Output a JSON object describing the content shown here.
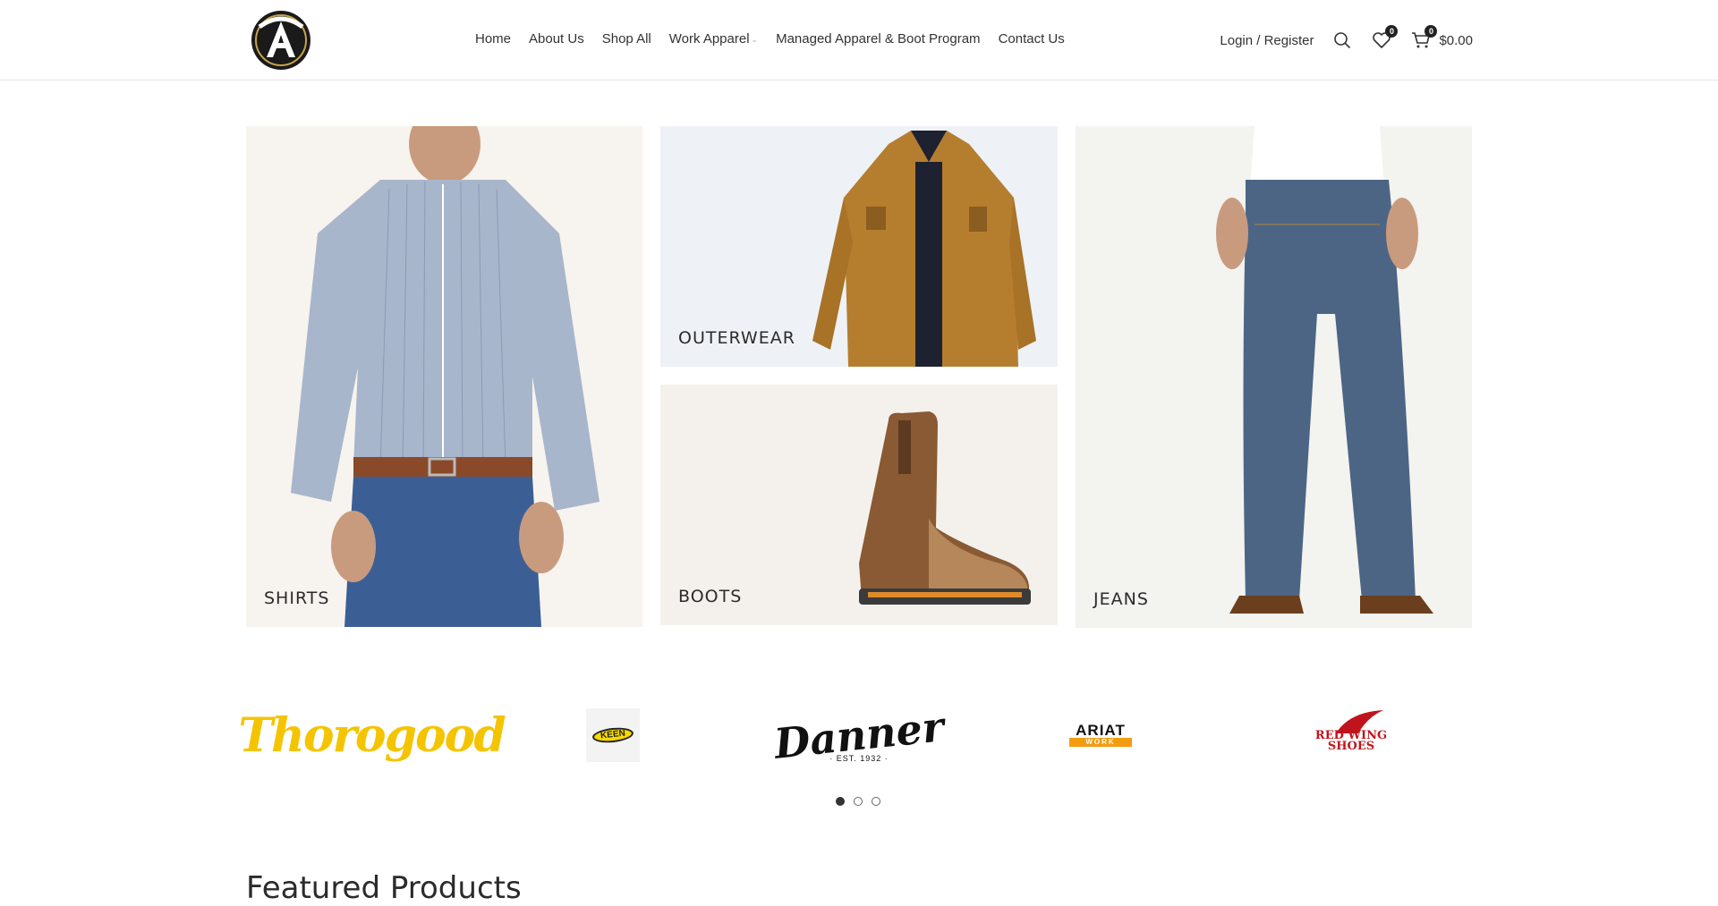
{
  "header": {
    "logo_alt": "CIRCLE A",
    "nav": [
      {
        "label": "Home"
      },
      {
        "label": "About Us"
      },
      {
        "label": "Shop All"
      },
      {
        "label": "Work Apparel"
      },
      {
        "label": "Managed Apparel & Boot Program"
      },
      {
        "label": "Contact Us"
      }
    ],
    "login_label": "Login / Register",
    "wishlist_count": "0",
    "cart_count": "0",
    "cart_total": "$0.00"
  },
  "categories": {
    "shirts": "SHIRTS",
    "outerwear": "OUTERWEAR",
    "boots": "BOOTS",
    "jeans": "JEANS"
  },
  "brands": {
    "thorogood": "Thorogood",
    "keen": "KEEN",
    "danner": "Danner",
    "danner_est": "· EST. 1932 ·",
    "ariat": "ARIAT",
    "ariat_sub": "WORK",
    "redwing_line1": "RED WING",
    "redwing_line2": "SHOES"
  },
  "featured": {
    "title": "Featured Products"
  },
  "colors": {
    "accent": "#333333",
    "thorogood": "#f5c400",
    "redwing": "#c0141c",
    "ariat": "#f39c12"
  }
}
